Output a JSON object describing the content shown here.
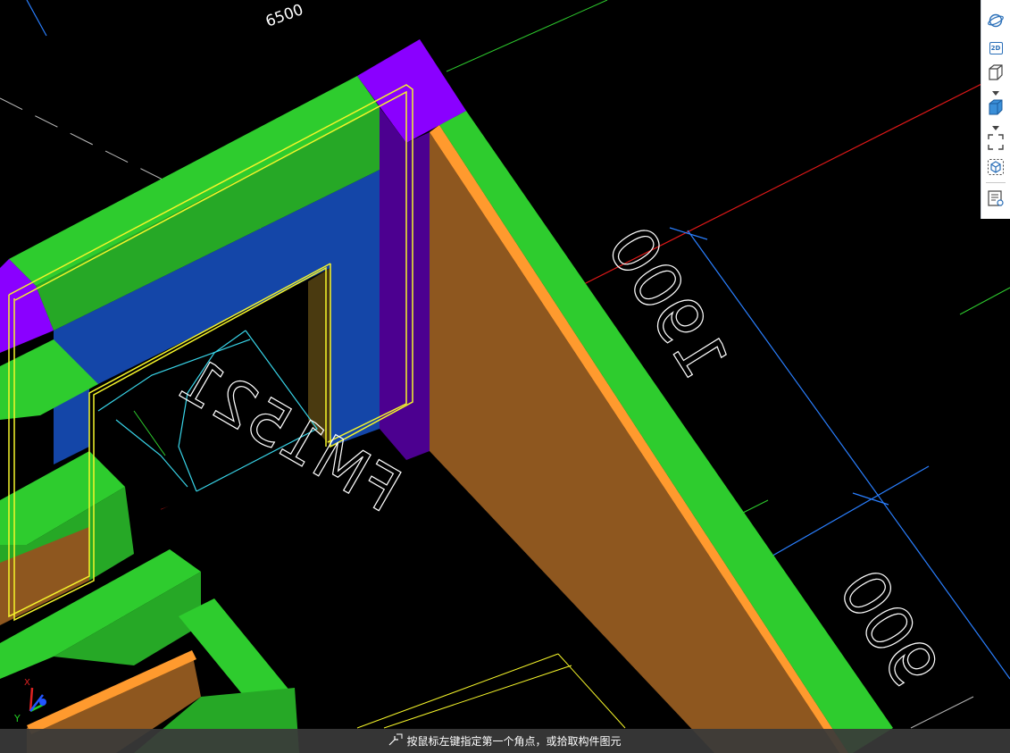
{
  "viewport": {
    "dimensions": {
      "top_span": "6500",
      "right_height": "1900",
      "bottom_right": "900"
    },
    "door_label": "FM1521"
  },
  "toolbar": {
    "items": [
      {
        "name": "orbit",
        "icon": "orbit-icon"
      },
      {
        "name": "2d-view",
        "icon": "2d-view-icon",
        "label": "2D"
      },
      {
        "name": "3d-view",
        "icon": "cube-outline-icon"
      },
      {
        "name": "display-mode",
        "icon": "cube-solid-icon"
      },
      {
        "name": "zoom-extents",
        "icon": "full-view-icon"
      },
      {
        "name": "component-view",
        "icon": "dashed-cube-icon"
      },
      {
        "name": "view-list",
        "icon": "list-view-icon"
      }
    ]
  },
  "axes": {
    "x": "X",
    "y": "Y"
  },
  "status": {
    "icon": "cursor-corner-icon",
    "message": "按鼠标左键指定第一个角点，或拾取构件图元"
  },
  "colors": {
    "background": "#000000",
    "wall_green": "#2ecc2e",
    "wall_side_green": "#26a826",
    "column_purple": "#8a00ff",
    "column_side": "#4c0090",
    "beam_blue": "#1446a8",
    "wall_brown": "#8e571f",
    "edge_orange": "#ff9a2e",
    "selection_yellow": "#f5f52a",
    "dim_blue": "#2a7fff",
    "axis_red": "#e01818",
    "text_white": "#ffffff",
    "cyan": "#38d4e8"
  }
}
